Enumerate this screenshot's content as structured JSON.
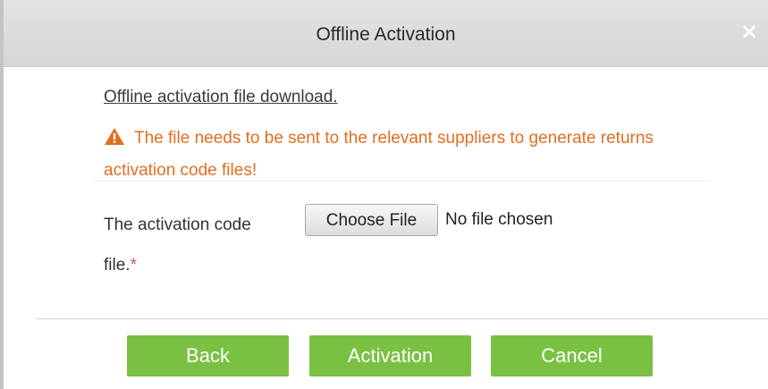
{
  "dialog": {
    "title": "Offline Activation",
    "close_symbol": "×"
  },
  "content": {
    "download_link": "Offline activation file download.",
    "warning_icon": "warning-triangle-icon",
    "warning_text": "The file needs to be sent to the relevant suppliers to generate returns activation code files!",
    "field_label": "The activation code file.",
    "required_marker": "*",
    "choose_file_label": "Choose File",
    "file_status": "No file chosen"
  },
  "buttons": {
    "back": "Back",
    "activation": "Activation",
    "cancel": "Cancel"
  },
  "colors": {
    "button_green": "#7ac143",
    "warning_orange": "#e06f22",
    "required_red": "#d9534f"
  }
}
